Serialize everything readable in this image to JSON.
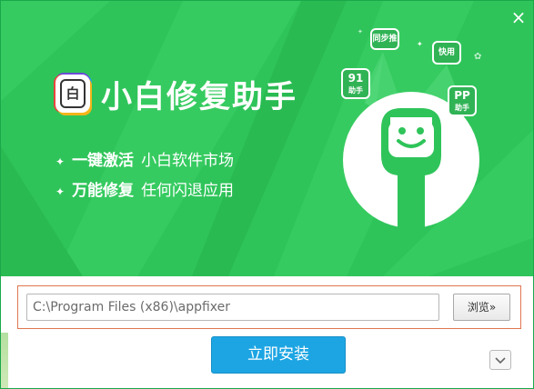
{
  "window": {
    "close_label": "×"
  },
  "banner": {
    "logo_char": "白",
    "app_title": "小白修复助手",
    "features": [
      {
        "star": "✦",
        "bold": "一键激活",
        "text": "小白软件市场"
      },
      {
        "star": "✦",
        "bold": "万能修复",
        "text": "任何闪退应用"
      }
    ],
    "badges": {
      "tongbu": "同步推",
      "kuaiyong": "快用",
      "n91_big": "91",
      "n91_small": "助手",
      "pp_big": "PP",
      "pp_small": "助手"
    }
  },
  "installer": {
    "path_value": "C:\\Program Files (x86)\\appfixer",
    "browse_label": "浏览»",
    "install_label": "立即安装"
  },
  "colors": {
    "banner_green": "#2fc45a",
    "install_blue": "#1da5e3",
    "frame_orange": "#e0774f"
  },
  "icons": [
    "close-icon",
    "app-logo-icon",
    "chevron-down-icon",
    "mascot-illustration"
  ]
}
